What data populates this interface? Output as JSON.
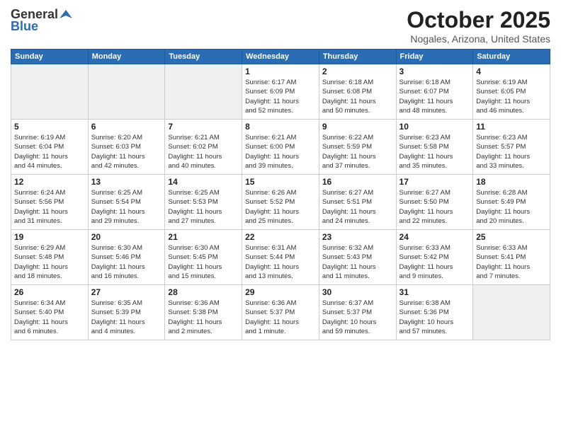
{
  "header": {
    "logo_line1": "General",
    "logo_line2": "Blue",
    "month_title": "October 2025",
    "location": "Nogales, Arizona, United States"
  },
  "weekdays": [
    "Sunday",
    "Monday",
    "Tuesday",
    "Wednesday",
    "Thursday",
    "Friday",
    "Saturday"
  ],
  "weeks": [
    [
      {
        "day": "",
        "empty": true
      },
      {
        "day": "",
        "empty": true
      },
      {
        "day": "",
        "empty": true
      },
      {
        "day": "1",
        "info": "Sunrise: 6:17 AM\nSunset: 6:09 PM\nDaylight: 11 hours\nand 52 minutes."
      },
      {
        "day": "2",
        "info": "Sunrise: 6:18 AM\nSunset: 6:08 PM\nDaylight: 11 hours\nand 50 minutes."
      },
      {
        "day": "3",
        "info": "Sunrise: 6:18 AM\nSunset: 6:07 PM\nDaylight: 11 hours\nand 48 minutes."
      },
      {
        "day": "4",
        "info": "Sunrise: 6:19 AM\nSunset: 6:05 PM\nDaylight: 11 hours\nand 46 minutes."
      }
    ],
    [
      {
        "day": "5",
        "info": "Sunrise: 6:19 AM\nSunset: 6:04 PM\nDaylight: 11 hours\nand 44 minutes."
      },
      {
        "day": "6",
        "info": "Sunrise: 6:20 AM\nSunset: 6:03 PM\nDaylight: 11 hours\nand 42 minutes."
      },
      {
        "day": "7",
        "info": "Sunrise: 6:21 AM\nSunset: 6:02 PM\nDaylight: 11 hours\nand 40 minutes."
      },
      {
        "day": "8",
        "info": "Sunrise: 6:21 AM\nSunset: 6:00 PM\nDaylight: 11 hours\nand 39 minutes."
      },
      {
        "day": "9",
        "info": "Sunrise: 6:22 AM\nSunset: 5:59 PM\nDaylight: 11 hours\nand 37 minutes."
      },
      {
        "day": "10",
        "info": "Sunrise: 6:23 AM\nSunset: 5:58 PM\nDaylight: 11 hours\nand 35 minutes."
      },
      {
        "day": "11",
        "info": "Sunrise: 6:23 AM\nSunset: 5:57 PM\nDaylight: 11 hours\nand 33 minutes."
      }
    ],
    [
      {
        "day": "12",
        "info": "Sunrise: 6:24 AM\nSunset: 5:56 PM\nDaylight: 11 hours\nand 31 minutes."
      },
      {
        "day": "13",
        "info": "Sunrise: 6:25 AM\nSunset: 5:54 PM\nDaylight: 11 hours\nand 29 minutes."
      },
      {
        "day": "14",
        "info": "Sunrise: 6:25 AM\nSunset: 5:53 PM\nDaylight: 11 hours\nand 27 minutes."
      },
      {
        "day": "15",
        "info": "Sunrise: 6:26 AM\nSunset: 5:52 PM\nDaylight: 11 hours\nand 25 minutes."
      },
      {
        "day": "16",
        "info": "Sunrise: 6:27 AM\nSunset: 5:51 PM\nDaylight: 11 hours\nand 24 minutes."
      },
      {
        "day": "17",
        "info": "Sunrise: 6:27 AM\nSunset: 5:50 PM\nDaylight: 11 hours\nand 22 minutes."
      },
      {
        "day": "18",
        "info": "Sunrise: 6:28 AM\nSunset: 5:49 PM\nDaylight: 11 hours\nand 20 minutes."
      }
    ],
    [
      {
        "day": "19",
        "info": "Sunrise: 6:29 AM\nSunset: 5:48 PM\nDaylight: 11 hours\nand 18 minutes."
      },
      {
        "day": "20",
        "info": "Sunrise: 6:30 AM\nSunset: 5:46 PM\nDaylight: 11 hours\nand 16 minutes."
      },
      {
        "day": "21",
        "info": "Sunrise: 6:30 AM\nSunset: 5:45 PM\nDaylight: 11 hours\nand 15 minutes."
      },
      {
        "day": "22",
        "info": "Sunrise: 6:31 AM\nSunset: 5:44 PM\nDaylight: 11 hours\nand 13 minutes."
      },
      {
        "day": "23",
        "info": "Sunrise: 6:32 AM\nSunset: 5:43 PM\nDaylight: 11 hours\nand 11 minutes."
      },
      {
        "day": "24",
        "info": "Sunrise: 6:33 AM\nSunset: 5:42 PM\nDaylight: 11 hours\nand 9 minutes."
      },
      {
        "day": "25",
        "info": "Sunrise: 6:33 AM\nSunset: 5:41 PM\nDaylight: 11 hours\nand 7 minutes."
      }
    ],
    [
      {
        "day": "26",
        "info": "Sunrise: 6:34 AM\nSunset: 5:40 PM\nDaylight: 11 hours\nand 6 minutes."
      },
      {
        "day": "27",
        "info": "Sunrise: 6:35 AM\nSunset: 5:39 PM\nDaylight: 11 hours\nand 4 minutes."
      },
      {
        "day": "28",
        "info": "Sunrise: 6:36 AM\nSunset: 5:38 PM\nDaylight: 11 hours\nand 2 minutes."
      },
      {
        "day": "29",
        "info": "Sunrise: 6:36 AM\nSunset: 5:37 PM\nDaylight: 11 hours\nand 1 minute."
      },
      {
        "day": "30",
        "info": "Sunrise: 6:37 AM\nSunset: 5:37 PM\nDaylight: 10 hours\nand 59 minutes."
      },
      {
        "day": "31",
        "info": "Sunrise: 6:38 AM\nSunset: 5:36 PM\nDaylight: 10 hours\nand 57 minutes."
      },
      {
        "day": "",
        "empty": true
      }
    ]
  ]
}
